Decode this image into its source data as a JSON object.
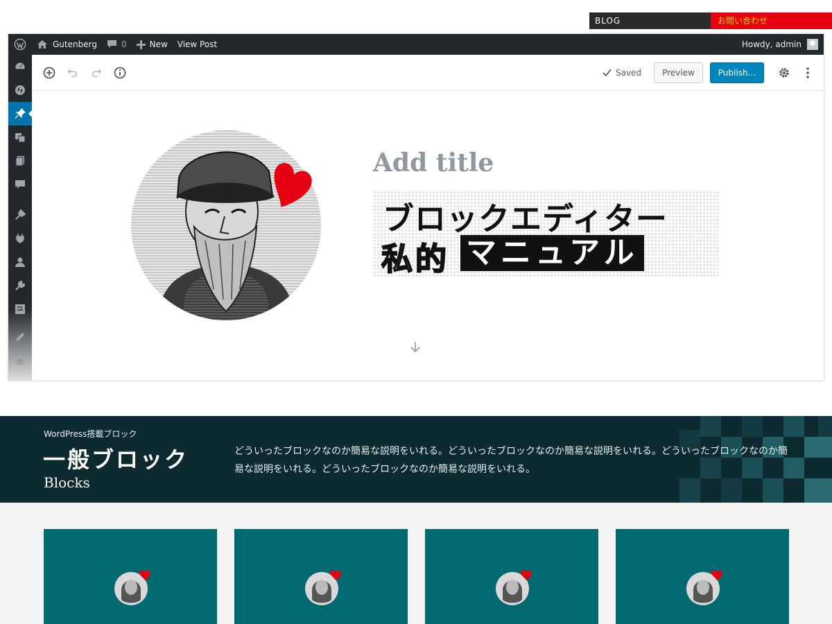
{
  "site_nav": {
    "blog": "BLOG",
    "contact": "お問い合わせ"
  },
  "adminbar": {
    "site_name": "Gutenberg",
    "comments_count": "0",
    "new_label": "New",
    "view_post": "View Post",
    "howdy": "Howdy, admin"
  },
  "admin_menu": [
    {
      "icon": "dashboard-icon"
    },
    {
      "icon": "jetpack-icon"
    },
    {
      "icon": "pin-icon",
      "active": true
    },
    {
      "icon": "media-icon"
    },
    {
      "icon": "pages-icon"
    },
    {
      "icon": "comments-icon"
    },
    {
      "icon": "appearance-icon"
    },
    {
      "icon": "plugins-icon"
    },
    {
      "icon": "users-icon"
    },
    {
      "icon": "tools-icon"
    },
    {
      "icon": "settings-icon"
    },
    {
      "icon": "edit-icon"
    },
    {
      "icon": "play-icon"
    }
  ],
  "toolbar": {
    "saved": "Saved",
    "preview": "Preview",
    "publish": "Publish..."
  },
  "editor": {
    "title_placeholder": "Add title",
    "hero_line1": "ブロックエディター",
    "hero_line2_outline": "私的",
    "hero_line2_box": "マニュアル"
  },
  "band": {
    "subtitle": "WordPress搭載ブロック",
    "title": "一般ブロック",
    "title_en": "Blocks",
    "description": "どういったブロックなのか簡易な説明をいれる。どういったブロックなのか簡易な説明をいれる。どういったブロックなのか簡易な説明をいれる。どういったブロックなのか簡易な説明をいれる。"
  },
  "colors": {
    "admin_bar": "#23282d",
    "accent_blue": "#0085ba",
    "band": "#0c2a30",
    "card": "#006a70",
    "heart": "#e60012"
  },
  "cards": [
    {},
    {},
    {},
    {}
  ]
}
